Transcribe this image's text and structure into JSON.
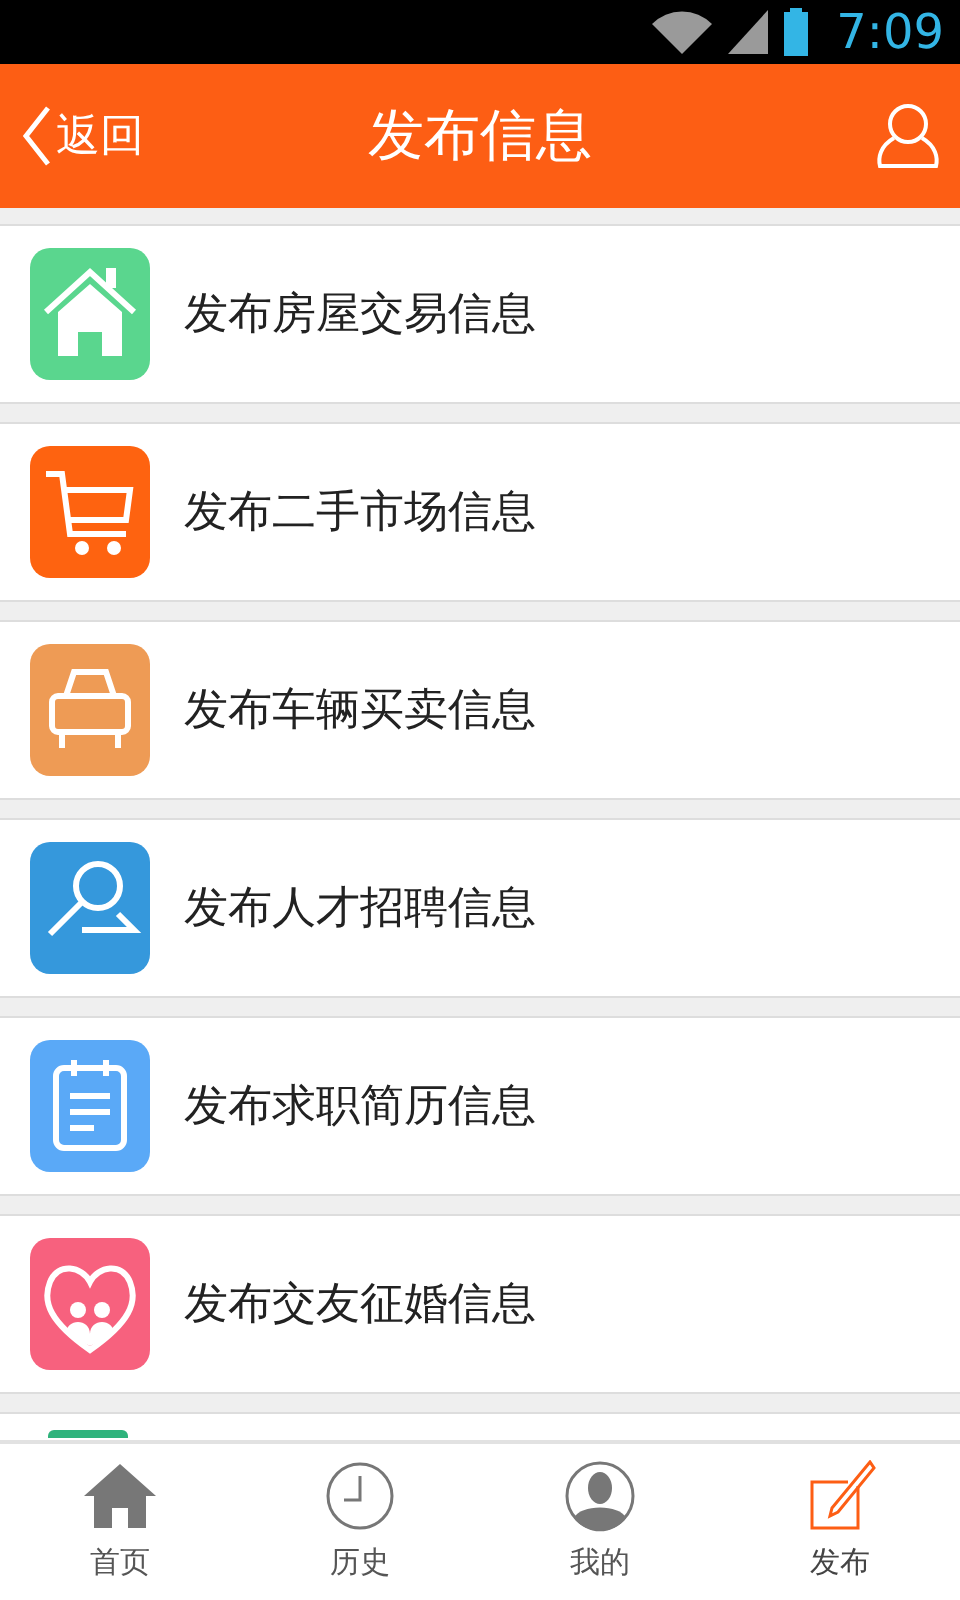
{
  "status_bar": {
    "time": "7:09"
  },
  "header": {
    "back": "返回",
    "title": "发布信息"
  },
  "items": [
    {
      "label": "发布房屋交易信息",
      "kind": "house",
      "color": "#5ad68e"
    },
    {
      "label": "发布二手市场信息",
      "kind": "cart",
      "color": "#fe6310"
    },
    {
      "label": "发布车辆买卖信息",
      "kind": "car",
      "color": "#ee9b55"
    },
    {
      "label": "发布人才招聘信息",
      "kind": "search",
      "color": "#3598dc"
    },
    {
      "label": "发布求职简历信息",
      "kind": "calendar",
      "color": "#5aa9f7"
    },
    {
      "label": "发布交友征婚信息",
      "kind": "heart",
      "color": "#f7617e"
    }
  ],
  "tab_bar": [
    {
      "label": "首页",
      "kind": "home",
      "selected": false
    },
    {
      "label": "历史",
      "kind": "clock",
      "selected": false
    },
    {
      "label": "我的",
      "kind": "person",
      "selected": false
    },
    {
      "label": "发布",
      "kind": "edit",
      "selected": true
    }
  ]
}
